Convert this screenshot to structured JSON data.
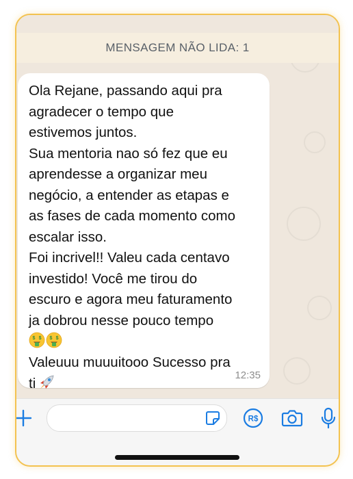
{
  "banner": {
    "text": "MENSAGEM NÃO LIDA: 1"
  },
  "message": {
    "lines": [
      "Ola Rejane, passando aqui pra",
      "agradecer o tempo que",
      "estivemos juntos.",
      "Sua mentoria nao só fez que eu",
      "aprendesse a organizar meu",
      "negócio, a entender as etapas e",
      "as fases de cada momento como",
      "escalar isso.",
      "Foi incrivel!! Valeu cada centavo",
      "investido! Você me tirou do",
      "escuro e agora meu faturamento",
      "ja dobrou nesse pouco tempo",
      "",
      "Valeuuu muuuitooo Sucesso pra",
      "ti"
    ],
    "emojis": [
      "money-mouth-face",
      "money-mouth-face",
      "rocket"
    ],
    "time": "12:35"
  },
  "input_bar": {
    "placeholder": "",
    "icons": [
      "plus-icon",
      "sticker-icon",
      "payment-icon",
      "camera-icon",
      "microphone-icon"
    ],
    "pay_label": "R$"
  },
  "colors": {
    "frame_border": "#f3c24f",
    "chat_background": "#efe7dd",
    "banner_background": "#f6eedf",
    "accent_blue": "#1a7ce2"
  }
}
